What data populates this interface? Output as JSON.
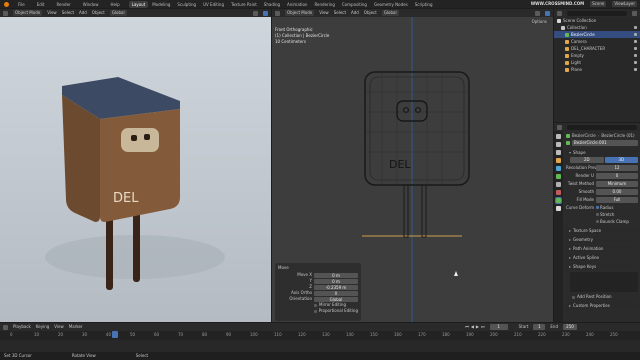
{
  "menu": {
    "items": [
      "File",
      "Edit",
      "Render",
      "Window",
      "Help"
    ],
    "workspaces": [
      "Layout",
      "Modeling",
      "Sculpting",
      "UV Editing",
      "Texture Paint",
      "Shading",
      "Animation",
      "Rendering",
      "Compositing",
      "Geometry Nodes",
      "Scripting"
    ],
    "active_workspace": "Layout",
    "watermark": "WWW.CROSSMIND.COM",
    "scene": "Scene",
    "view_layer": "ViewLayer"
  },
  "left_viewport": {
    "mode": "Object Mode",
    "menus": [
      "View",
      "Select",
      "Add",
      "Object"
    ],
    "global": "Global",
    "options": "Options",
    "logo_text": "DEL"
  },
  "right_viewport": {
    "mode": "Object Mode",
    "menus": [
      "View",
      "Select",
      "Add",
      "Object"
    ],
    "global": "Global",
    "options": "Options",
    "info_title": "Front Orthographic",
    "info_collection": "(1) Collection | BezierCircle",
    "info_units": "10 Centimeters",
    "logo_text": "DEL"
  },
  "operator_panel": {
    "title": "Move",
    "labels": [
      "Move X",
      "Y",
      "Z",
      "Axis Ortho",
      "Orientation"
    ],
    "values": [
      "0 m",
      "0 m",
      "-0.2359 m",
      "X",
      "Global"
    ],
    "checkboxes": [
      "Mirror Editing",
      "Proportional Editing"
    ]
  },
  "outliner": {
    "title": "Scene Collection",
    "items": [
      {
        "name": "Collection",
        "depth": 1,
        "icon_color": "#c8c8c8"
      },
      {
        "name": "BezierCircle",
        "depth": 2,
        "icon_color": "#62b855",
        "selected": true
      },
      {
        "name": "Camera",
        "depth": 2,
        "icon_color": "#e3a74b"
      },
      {
        "name": "DEL_CHARACTER",
        "depth": 2,
        "icon_color": "#e3a74b"
      },
      {
        "name": "Empty",
        "depth": 2,
        "icon_color": "#e3a74b"
      },
      {
        "name": "Light",
        "depth": 2,
        "icon_color": "#e3a74b"
      },
      {
        "name": "Plane",
        "depth": 2,
        "icon_color": "#e3a74b"
      }
    ]
  },
  "properties": {
    "object_name": "BezierCircle",
    "data_name": "BezierCircle (01)",
    "data_field": "BezierCircle.001",
    "shape": {
      "title": "Shape",
      "buttons": [
        "2D",
        "3D"
      ],
      "active": "3D",
      "rows": [
        {
          "label": "Resolution Preview",
          "value": "12"
        },
        {
          "label": "Render U",
          "value": "0"
        },
        {
          "label": "Twist Method",
          "value": "Minimum"
        },
        {
          "label": "Smooth",
          "value": "0.00"
        },
        {
          "label": "Fill Mode",
          "value": "Full"
        }
      ],
      "curve_deform": "Curve Deform",
      "checks": [
        "Radius",
        "Stretch",
        "Bounds Clamp"
      ]
    },
    "sections": [
      "Texture Space",
      "Geometry",
      "Path Animation",
      "Active Spline",
      "Shape Keys",
      "Custom Properties"
    ],
    "add_rest": "Add Rest Position"
  },
  "timeline": {
    "menus": [
      "Playback",
      "Keying",
      "View",
      "Marker"
    ],
    "current_frame": "1",
    "start_label": "Start",
    "start": "1",
    "end_label": "End",
    "end": "250",
    "ticks": [
      "0",
      "10",
      "20",
      "30",
      "40",
      "50",
      "60",
      "70",
      "80",
      "90",
      "100",
      "110",
      "120",
      "130",
      "140",
      "150",
      "160",
      "170",
      "180",
      "190",
      "200",
      "210",
      "220",
      "230",
      "240",
      "250"
    ]
  },
  "status": {
    "left": "Set 3D Cursor",
    "middle": "Rotate View",
    "right": "Select"
  },
  "colors": {
    "accent": "#4772b3",
    "selection": "#e3a74b",
    "object_green": "#62b855"
  }
}
